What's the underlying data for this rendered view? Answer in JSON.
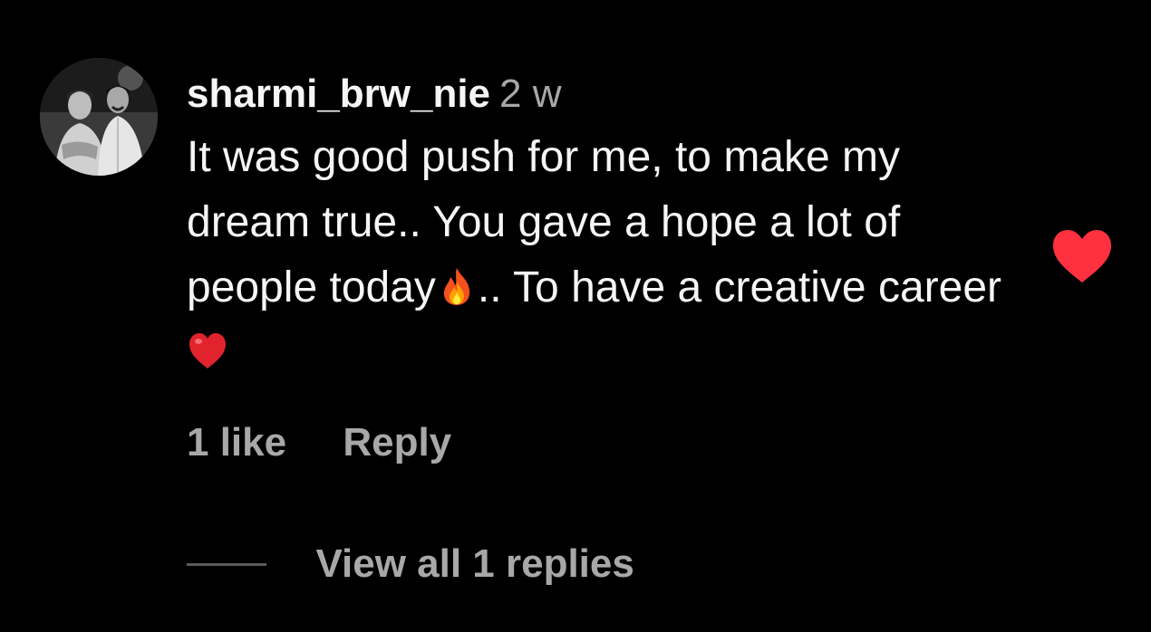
{
  "comment": {
    "username": "sharmi_brw_nie",
    "time": "2 w",
    "text_part1": "It was good push for me, to make my dream true.. You gave a hope a lot of people today",
    "text_part2": ".. To have a creative career",
    "emoji_1": "fire-emoji",
    "emoji_2": "red-heart-emoji",
    "likes": "1 like",
    "reply_label": "Reply",
    "view_replies": "View all 1 replies",
    "liked": true
  },
  "colors": {
    "background": "#000000",
    "primary_text": "#f5f5f5",
    "secondary_text": "#a8a8a8",
    "like_heart": "#ff3040"
  }
}
